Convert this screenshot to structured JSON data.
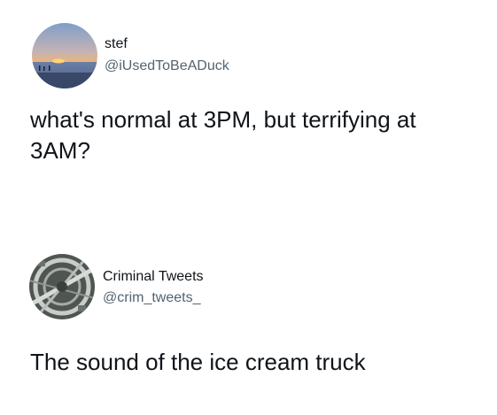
{
  "tweets": [
    {
      "avatar": "sunset-beach-avatar",
      "display_name": "stef",
      "handle": "@iUsedToBeADuck",
      "text": "what's normal at 3PM, but terrifying at 3AM?"
    },
    {
      "avatar": "highway-interchange-avatar",
      "display_name": "Criminal Tweets",
      "handle": "@crim_tweets_",
      "text": "The sound of the ice cream truck"
    }
  ],
  "colors": {
    "text_primary": "#0f1419",
    "text_secondary": "#536471",
    "background": "#ffffff"
  }
}
